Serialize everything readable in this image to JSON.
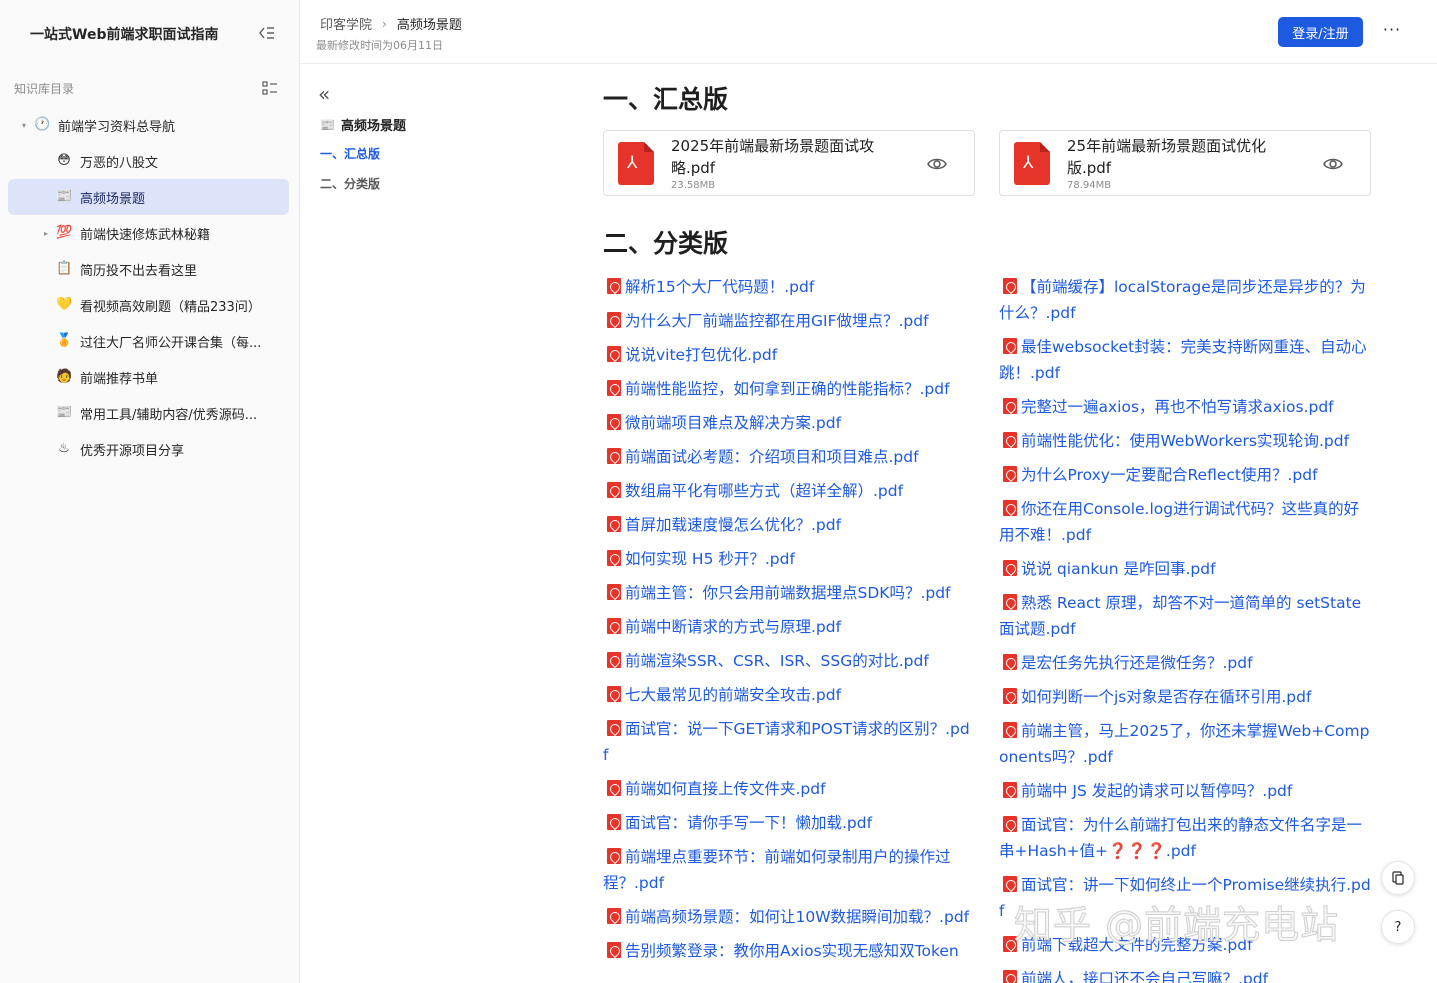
{
  "sidebar": {
    "title": "一站式Web前端求职面试指南",
    "section_label": "知识库目录",
    "items": [
      {
        "label": "前端学习资料总导航",
        "emoji": "🕐",
        "level": 0,
        "arrow": "▾"
      },
      {
        "label": "万恶的八股文",
        "emoji": "😳",
        "level": 1
      },
      {
        "label": "高频场景题",
        "emoji": "📰",
        "level": 1,
        "active": true
      },
      {
        "label": "前端快速修炼武林秘籍",
        "emoji": "💯",
        "level": 1,
        "arrow": "▸"
      },
      {
        "label": "简历投不出去看这里",
        "emoji": "📋",
        "level": 1
      },
      {
        "label": "看视频高效刷题（精品233问）",
        "emoji": "💛",
        "level": 1
      },
      {
        "label": "过往大厂名师公开课合集（每...",
        "emoji": "🏅",
        "level": 1
      },
      {
        "label": "前端推荐书单",
        "emoji": "🧑",
        "level": 1
      },
      {
        "label": "常用工具/辅助内容/优秀源码...",
        "emoji": "📰",
        "level": 1
      },
      {
        "label": "优秀开源项目分享",
        "emoji": "♨",
        "level": 1
      }
    ]
  },
  "header": {
    "breadcrumb": [
      "印客学院",
      "高频场景题"
    ],
    "separator": "›",
    "modified": "最新修改时间为06月11日",
    "login_label": "登录/注册",
    "more_label": "···"
  },
  "toc": {
    "back_label": "«",
    "title": "高频场景题",
    "title_emoji": "📰",
    "items": [
      "一、汇总版",
      "二、分类版"
    ]
  },
  "main": {
    "section1_title": "一、汇总版",
    "section2_title": "二、分类版",
    "files": [
      {
        "name": "2025年前端最新场景题面试攻略.pdf",
        "size": "23.58MB"
      },
      {
        "name": "25年前端最新场景题面试优化版.pdf",
        "size": "78.94MB"
      }
    ],
    "left_links": [
      "解析15个大厂代码题！.pdf",
      "为什么大厂前端监控都在用GIF做埋点？.pdf",
      "说说vite打包优化.pdf",
      "前端性能监控，如何拿到正确的性能指标？.pdf",
      "微前端项目难点及解决方案.pdf",
      "前端面试必考题：介绍项目和项目难点.pdf",
      "数组扁平化有哪些方式（超详全解）.pdf",
      "首屏加载速度慢怎么优化？.pdf",
      "如何实现 H5 秒开？.pdf",
      "前端主管：你只会用前端数据埋点SDK吗？.pdf",
      "前端中断请求的方式与原理.pdf",
      "前端渲染SSR、CSR、ISR、SSG的对比.pdf",
      "七大最常见的前端安全攻击.pdf",
      "面试官：说一下GET请求和POST请求的区别？.pdf",
      "前端如何直接上传文件夹.pdf",
      "面试官：请你手写一下！懒加载.pdf",
      "前端埋点重要环节：前端如何录制用户的操作过程？.pdf",
      "前端高频场景题：如何让10W数据瞬间加载？.pdf",
      "告别频繁登录：教你用Axios实现无感知双Token"
    ],
    "right_links": [
      "【前端缓存】localStorage是同步还是异步的？为什么？.pdf",
      "最佳websocket封装：完美支持断网重连、自动心跳！.pdf",
      "完整过一遍axios，再也不怕写请求axios.pdf",
      "前端性能优化：使用WebWorkers实现轮询.pdf",
      "为什么Proxy一定要配合Reflect使用？.pdf",
      "你还在用Console.log进行调试代码？这些真的好用不难！.pdf",
      "说说 qiankun 是咋回事.pdf",
      "熟悉 React 原理，却答不对一道简单的 setState 面试题.pdf",
      "是宏任务先执行还是微任务？.pdf",
      "如何判断一个js对象是否存在循环引用.pdf",
      "前端主管，马上2025了，你还未掌握Web+Components吗？.pdf",
      "前端中 JS 发起的请求可以暂停吗？.pdf",
      "面试官：为什么前端打包出来的静态文件名字是一串+Hash+值+❓❓❓.pdf",
      "面试官：讲一下如何终止一个Promise继续执行.pdf",
      "前端下载超大文件的完整方案.pdf",
      "前端人，接口还不会自己写嘛？.pdf"
    ]
  },
  "watermark": "知乎 @前端充电站",
  "colors": {
    "accent": "#1e5ae0",
    "active_bg": "#dde3f9",
    "pdf_red": "#e6342a"
  }
}
